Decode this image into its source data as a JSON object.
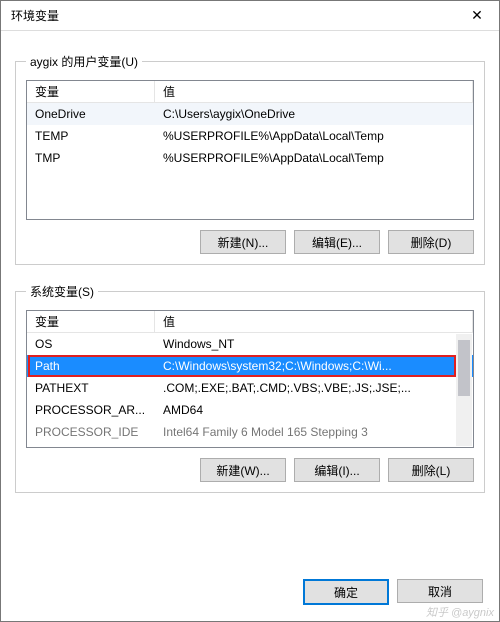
{
  "window": {
    "title": "环境变量",
    "close_label": "✕"
  },
  "user_section": {
    "legend": "aygix 的用户变量(U)",
    "head_name": "变量",
    "head_value": "值",
    "rows": [
      {
        "name": "OneDrive",
        "value": "C:\\Users\\aygix\\OneDrive"
      },
      {
        "name": "TEMP",
        "value": "%USERPROFILE%\\AppData\\Local\\Temp"
      },
      {
        "name": "TMP",
        "value": "%USERPROFILE%\\AppData\\Local\\Temp"
      }
    ],
    "buttons": {
      "new": "新建(N)...",
      "edit": "编辑(E)...",
      "delete": "删除(D)"
    }
  },
  "system_section": {
    "legend": "系统变量(S)",
    "head_name": "变量",
    "head_value": "值",
    "rows": [
      {
        "name": "OS",
        "value": "Windows_NT"
      },
      {
        "name": "Path",
        "value": "C:\\Windows\\system32;C:\\Windows;C:\\Wi...",
        "selected": true
      },
      {
        "name": "PATHEXT",
        "value": ".COM;.EXE;.BAT;.CMD;.VBS;.VBE;.JS;.JSE;..."
      },
      {
        "name": "PROCESSOR_AR...",
        "value": "AMD64"
      },
      {
        "name": "PROCESSOR_IDE",
        "value": "Intel64 Family 6 Model 165 Stepping 3"
      }
    ],
    "buttons": {
      "new": "新建(W)...",
      "edit": "编辑(I)...",
      "delete": "删除(L)"
    }
  },
  "footer": {
    "ok": "确定",
    "cancel": "取消"
  },
  "watermark": "知乎 @aygnix"
}
